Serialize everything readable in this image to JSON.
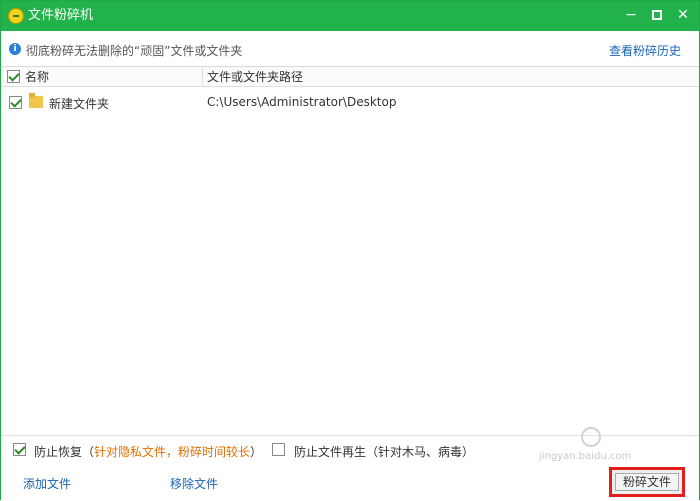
{
  "window": {
    "title": "文件粉碎机",
    "controls": {
      "minimize": "−",
      "close": "✕"
    },
    "icons": {
      "app": "shredder-app-icon"
    }
  },
  "info": {
    "icon": "info-icon",
    "text": "彻底粉碎无法删除的“顽固”文件或文件夹",
    "history_link": "查看粉碎历史"
  },
  "table": {
    "columns": {
      "name": "名称",
      "path": "文件或文件夹路径"
    },
    "header_checked": true,
    "rows": [
      {
        "checked": true,
        "icon": "folder-icon",
        "name": "新建文件夹",
        "path": "C:\\Users\\Administrator\\Desktop"
      }
    ]
  },
  "options": {
    "prevent_recovery": {
      "checked": true,
      "label": "防止恢复（",
      "note": "针对隐私文件，粉碎时间较长",
      "close": "）"
    },
    "prevent_regen": {
      "checked": false,
      "label": "防止文件再生（针对木马、病毒）"
    }
  },
  "footer": {
    "add_files": "添加文件",
    "remove_files": "移除文件",
    "shred_button": "粉碎文件"
  },
  "watermark": {
    "sub": "jingyan.baidu.com"
  },
  "colors": {
    "titlebar": "#22b24c",
    "link": "#1a64b8",
    "note": "#e07000",
    "highlight": "#e31c1c"
  }
}
